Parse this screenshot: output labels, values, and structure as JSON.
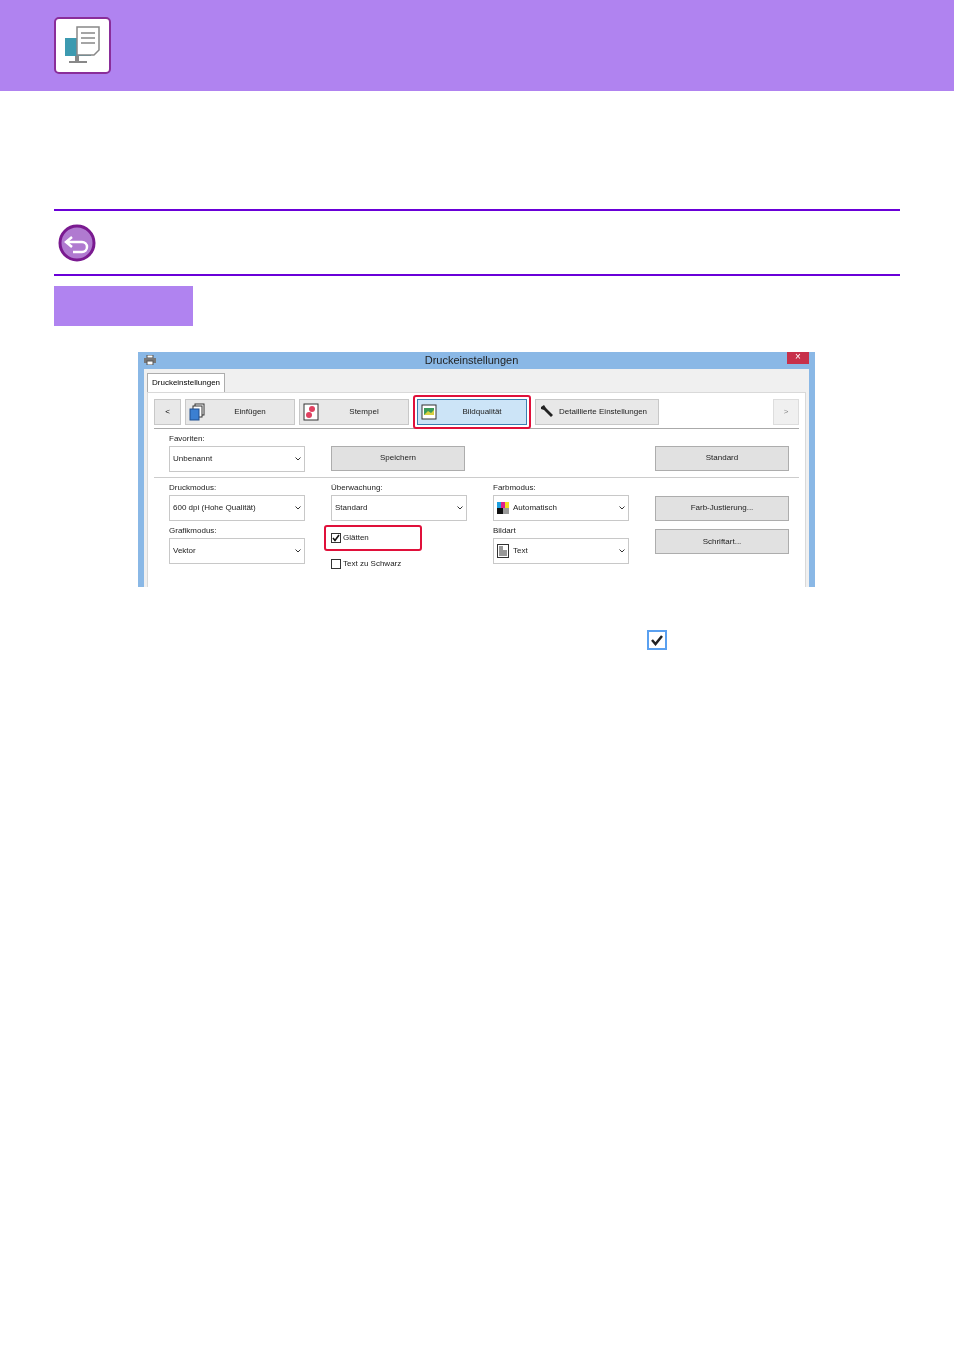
{
  "dialog": {
    "title": "Druckeinstellungen",
    "close": "×",
    "tab": {
      "label": "Druckeinstellungen",
      "selected": true
    },
    "nav_prev": "<",
    "nav_next": ">",
    "toolbar": [
      {
        "label": "Einfügen",
        "kind": "pages",
        "selected": false,
        "highlighted": false
      },
      {
        "label": "Stempel",
        "kind": "stamp",
        "selected": false,
        "highlighted": false
      },
      {
        "label": "Bildqualität",
        "kind": "image",
        "selected": true,
        "highlighted": true
      },
      {
        "label": "Detaillierte Einstellungen",
        "kind": "wrench",
        "selected": false,
        "highlighted": false
      }
    ],
    "favorites": {
      "label": "Favoriten:",
      "value": "Unbenannt"
    },
    "save_button": "Speichern",
    "default_button": "Standard",
    "print_mode": {
      "label": "Druckmodus:",
      "value": "600 dpi (Hohe Qualität)"
    },
    "monitoring": {
      "label": "Überwachung:",
      "value": "Standard"
    },
    "color_mode": {
      "label": "Farbmodus:",
      "value": "Automatisch"
    },
    "color_adjust_button": "Farb-Justierung...",
    "graphics_mode": {
      "label": "Grafikmodus:",
      "value": "Vektor"
    },
    "checkboxes": [
      {
        "label": "Glätten",
        "checked": true,
        "highlighted": true
      },
      {
        "label": "Text zu Schwarz",
        "checked": false,
        "highlighted": false
      }
    ],
    "image_type": {
      "label": "Bildart",
      "value": "Text"
    },
    "font_button": "Schriftart..."
  },
  "inline_checkbox": {
    "checked": true
  }
}
